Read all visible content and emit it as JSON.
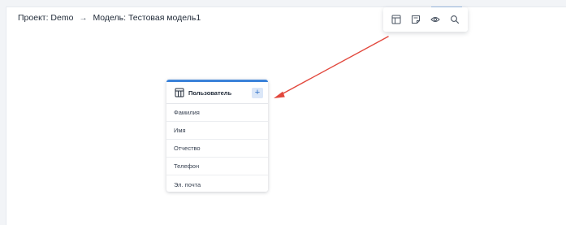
{
  "breadcrumb": {
    "project": "Проект: Demo",
    "separator": "→",
    "model": "Модель: Тестовая модель1"
  },
  "toolbar": {
    "icons": [
      "table-icon",
      "note-icon",
      "eye-icon",
      "search-icon"
    ]
  },
  "entity": {
    "title": "Пользователь",
    "add_label": "+",
    "fields": [
      "Фамилия",
      "Имя",
      "Отчество",
      "Телефон",
      "Эл. почта"
    ]
  },
  "colors": {
    "accent": "#3b82d9",
    "annotation_arrow": "#e2483d"
  }
}
